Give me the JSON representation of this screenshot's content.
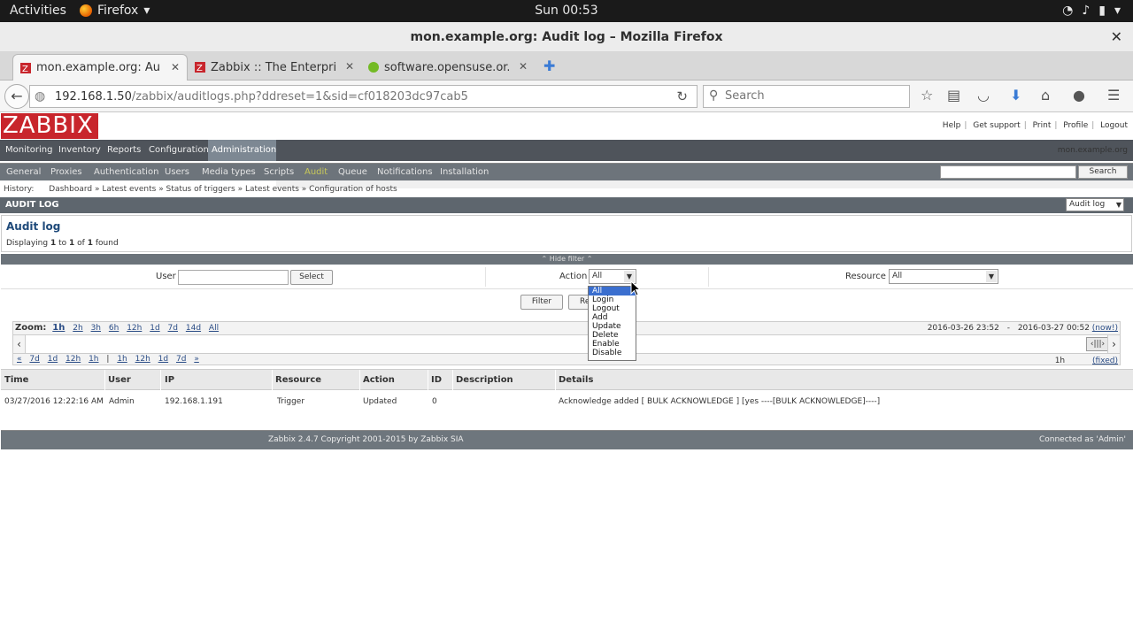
{
  "os": {
    "activities": "Activities",
    "app": "Firefox",
    "clock": "Sun 00:53"
  },
  "window": {
    "title": "mon.example.org: Audit log – Mozilla Firefox"
  },
  "tabs": [
    {
      "label": "mon.example.org: Au..."
    },
    {
      "label": "Zabbix :: The Enterpri..."
    },
    {
      "label": "software.opensuse.or..."
    }
  ],
  "navbar": {
    "url_host": "192.168.1.50",
    "url_path": "/zabbix/auditlogs.php?ddreset=1&sid=cf018203dc97cab5",
    "search_placeholder": "Search"
  },
  "zabbix": {
    "logo": "ZABBIX",
    "toplinks": [
      "Help",
      "Get support",
      "Print",
      "Profile",
      "Logout"
    ],
    "mainmenu": [
      "Monitoring",
      "Inventory",
      "Reports",
      "Configuration",
      "Administration"
    ],
    "hostname": "mon.example.org",
    "submenu": [
      "General",
      "Proxies",
      "Authentication",
      "Users",
      "Media types",
      "Scripts",
      "Audit",
      "Queue",
      "Notifications",
      "Installation"
    ],
    "search_button": "Search",
    "history_label": "History:",
    "history": "Dashboard » Latest events » Status of triggers » Latest events » Configuration of hosts",
    "section_title": "AUDIT LOG",
    "section_select": "Audit log",
    "page_title": "Audit log",
    "displaying": {
      "pre": "Displaying",
      "from": "1",
      "to_word": "to",
      "to": "1",
      "of_word": "of",
      "total": "1",
      "found": "found"
    },
    "hide_filter": "Hide filter",
    "filter": {
      "user_label": "User",
      "user_value": "",
      "select_button": "Select",
      "action_label": "Action",
      "action_value": "All",
      "resource_label": "Resource",
      "resource_value": "All",
      "filter_button": "Filter",
      "reset_button": "Re"
    },
    "action_options": [
      "All",
      "Login",
      "Logout",
      "Add",
      "Update",
      "Delete",
      "Enable",
      "Disable"
    ],
    "zoom": {
      "label": "Zoom:",
      "current": "1h",
      "options": [
        "2h",
        "3h",
        "6h",
        "12h",
        "1d",
        "7d",
        "14d",
        "All"
      ],
      "range_from": "2016-03-26 23:52",
      "range_sep": "-",
      "range_to": "2016-03-27 00:52",
      "now": "(now!)",
      "nav_back": [
        "«",
        "7d",
        "1d",
        "12h",
        "1h"
      ],
      "nav_sep": "|",
      "nav_fwd": [
        "1h",
        "12h",
        "1d",
        "7d",
        "»"
      ],
      "period": "1h",
      "fixed": "(fixed)"
    },
    "table": {
      "headers": [
        "Time",
        "User",
        "IP",
        "Resource",
        "Action",
        "ID",
        "Description",
        "Details"
      ],
      "rows": [
        [
          "03/27/2016 12:22:16 AM",
          "Admin",
          "192.168.1.191",
          "Trigger",
          "Updated",
          "0",
          "",
          "Acknowledge added [ BULK ACKNOWLEDGE ] [yes ----[BULK ACKNOWLEDGE]----]"
        ]
      ]
    },
    "footer_copyright": "Zabbix 2.4.7 Copyright 2001-2015 by Zabbix SIA",
    "footer_connected": "Connected as 'Admin'"
  }
}
